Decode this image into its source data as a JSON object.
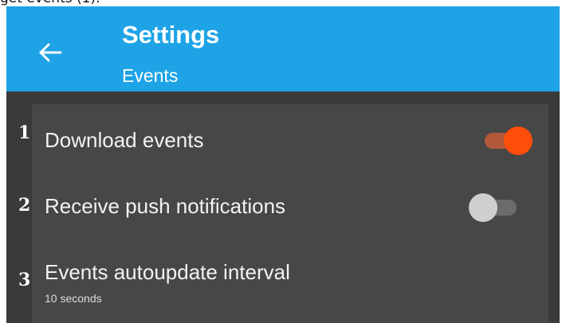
{
  "fragment": {
    "text": "get events (1)."
  },
  "header": {
    "title": "Settings",
    "subtitle": "Events",
    "back_icon": "arrow-left-icon"
  },
  "settings": [
    {
      "number": "1",
      "label": "Download events",
      "control": "toggle",
      "on": true
    },
    {
      "number": "2",
      "label": "Receive push notifications",
      "control": "toggle",
      "on": false
    },
    {
      "number": "3",
      "label": "Events autoupdate interval",
      "value": "10 seconds"
    }
  ],
  "colors": {
    "appbar": "#1ea3e6",
    "panel": "#474747",
    "background": "#3a3a3a",
    "toggle_on_thumb": "#ff4d0a",
    "toggle_on_track": "#b2593a",
    "toggle_off_thumb": "#cfcfcf",
    "toggle_off_track": "#6b6b6b"
  }
}
